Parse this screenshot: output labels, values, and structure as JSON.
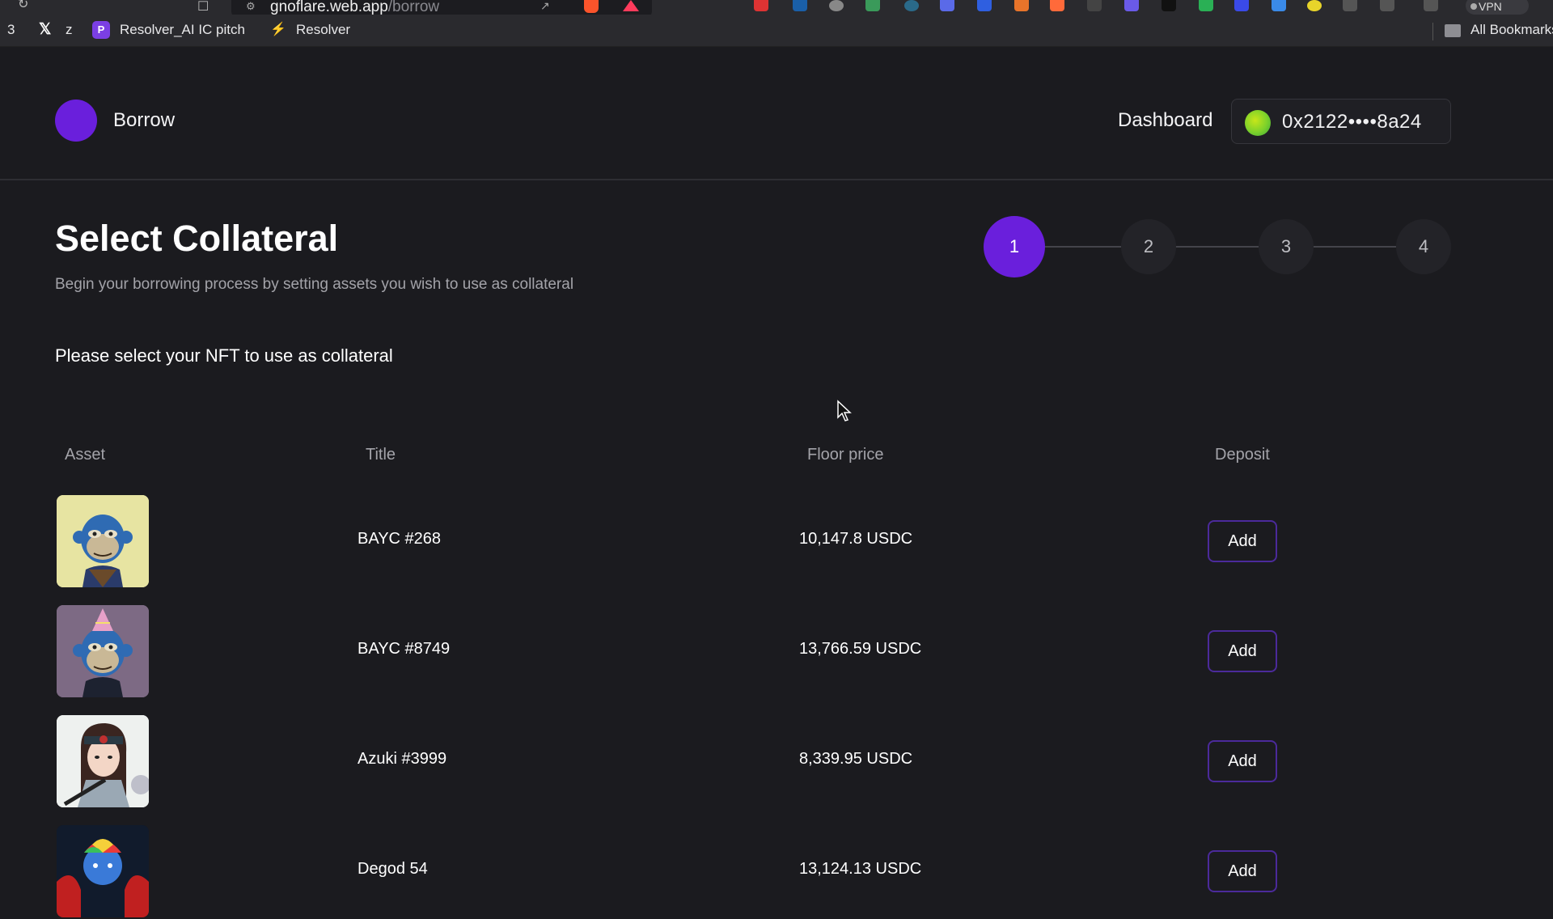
{
  "browser": {
    "url_host": "gnoflare.web.app",
    "url_path": "/borrow",
    "vpn_label": "VPN",
    "bookmarks": [
      {
        "label": "3"
      },
      {
        "label": "z"
      },
      {
        "label": "Resolver_AI IC pitch"
      },
      {
        "label": "Resolver"
      }
    ],
    "all_bookmarks_label": "All Bookmarks"
  },
  "header": {
    "brand": "Borrow",
    "nav_dashboard": "Dashboard",
    "wallet_address": "0x2122••••8a24"
  },
  "page": {
    "title": "Select Collateral",
    "subtitle": "Begin your borrowing process by setting assets you wish to use as collateral",
    "prompt": "Please select your NFT to use as collateral"
  },
  "stepper": {
    "steps": [
      "1",
      "2",
      "3",
      "4"
    ],
    "active_step": 1
  },
  "table": {
    "headers": {
      "asset": "Asset",
      "title": "Title",
      "floor_price": "Floor price",
      "deposit": "Deposit"
    },
    "rows": [
      {
        "title": "BAYC #268",
        "floor_price": "10,147.8 USDC",
        "action": "Add"
      },
      {
        "title": "BAYC #8749",
        "floor_price": "13,766.59 USDC",
        "action": "Add"
      },
      {
        "title": "Azuki #3999",
        "floor_price": "8,339.95 USDC",
        "action": "Add"
      },
      {
        "title": "Degod 54",
        "floor_price": "13,124.13 USDC",
        "action": "Add"
      }
    ]
  },
  "colors": {
    "accent": "#6a1fdc",
    "background": "#1b1b1f",
    "muted_text": "#a3a3a9"
  }
}
